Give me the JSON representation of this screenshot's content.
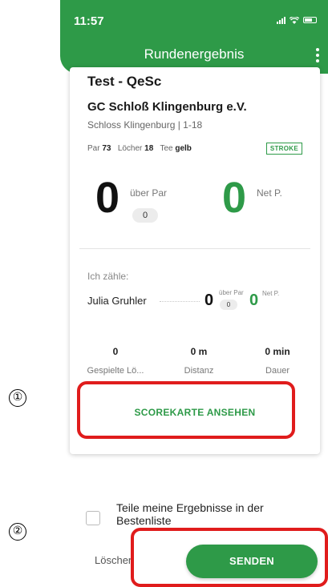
{
  "status_bar": {
    "time": "11:57"
  },
  "app_bar": {
    "title": "Rundenergebnis"
  },
  "round": {
    "name": "Test - QeSc",
    "club": "GC Schloß Klingenburg e.V.",
    "course": "Schloss Klingenburg | 1-18",
    "par_label": "Par",
    "par_value": "73",
    "holes_label": "Löcher",
    "holes_value": "18",
    "tee_label": "Tee",
    "tee_value": "gelb",
    "format_badge": "STROKE"
  },
  "score": {
    "gross": "0",
    "over_par_label": "über Par",
    "over_par_value": "0",
    "net": "0",
    "net_label": "Net P."
  },
  "counting": {
    "label": "Ich zähle:",
    "players": [
      {
        "name": "Julia Gruhler",
        "score": "0",
        "over_par_label": "über Par",
        "over_par_value": "0",
        "net": "0",
        "net_label": "Net P."
      }
    ]
  },
  "stats": [
    {
      "value": "0",
      "label": "Gespielte Lö..."
    },
    {
      "value": "0 m",
      "label": "Distanz"
    },
    {
      "value": "0 min",
      "label": "Dauer"
    }
  ],
  "scorecard_button": "SCOREKARTE ANSEHEN",
  "share": {
    "label": "Teile meine Ergebnisse in der Bestenliste",
    "checked": false
  },
  "actions": {
    "delete": "Löschen",
    "send": "SENDEN"
  },
  "annotations": [
    {
      "number": "①"
    },
    {
      "number": "②"
    }
  ],
  "colors": {
    "primary": "#2e9a48",
    "annotation": "#e01c1c"
  }
}
